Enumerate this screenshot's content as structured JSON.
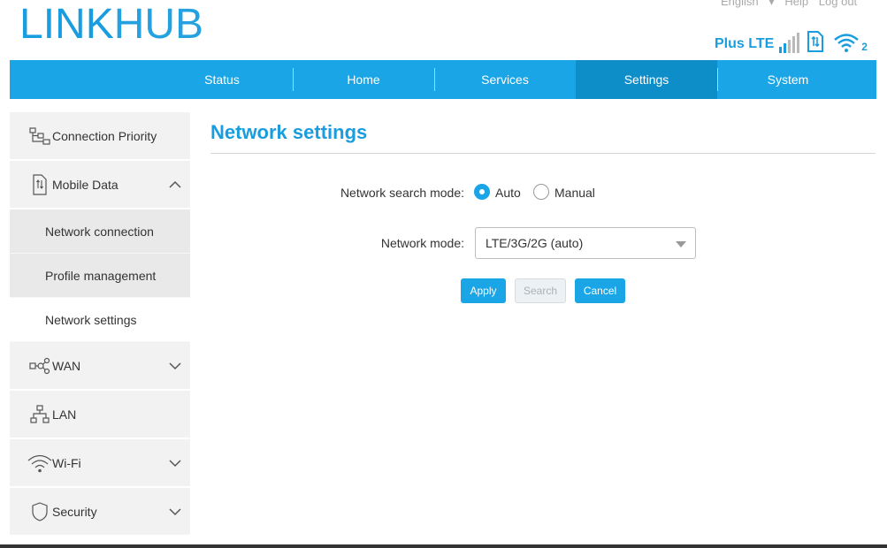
{
  "header": {
    "logo_bold": "LINK",
    "logo_thin": "HUB",
    "language": "English",
    "help": "Help",
    "logout": "Log out",
    "carrier": "Plus",
    "network_type": "LTE",
    "wifi_clients": "2"
  },
  "nav": {
    "items": [
      "Status",
      "Home",
      "Services",
      "Settings",
      "System"
    ],
    "active": "Settings"
  },
  "sidebar": {
    "items": [
      {
        "label": "Connection Priority",
        "icon": "connection-priority-icon"
      },
      {
        "label": "Mobile Data",
        "icon": "mobile-data-icon",
        "expanded": true
      },
      {
        "label": "WAN",
        "icon": "wan-icon"
      },
      {
        "label": "LAN",
        "icon": "lan-icon"
      },
      {
        "label": "Wi-Fi",
        "icon": "wifi-icon"
      },
      {
        "label": "Security",
        "icon": "shield-icon"
      }
    ],
    "mobile_data_sub": [
      "Network connection",
      "Profile management",
      "Network settings"
    ],
    "active_sub": "Network settings"
  },
  "main": {
    "title": "Network settings",
    "search_mode_label": "Network search mode:",
    "search_mode_options": [
      "Auto",
      "Manual"
    ],
    "search_mode_selected": "Auto",
    "network_mode_label": "Network mode:",
    "network_mode_value": "LTE/3G/2G (auto)",
    "buttons": {
      "apply": "Apply",
      "search": "Search",
      "cancel": "Cancel"
    }
  },
  "colors": {
    "accent": "#1aa5e6",
    "accent_dark": "#0e8ec9",
    "logo": "#1a9ddf"
  }
}
